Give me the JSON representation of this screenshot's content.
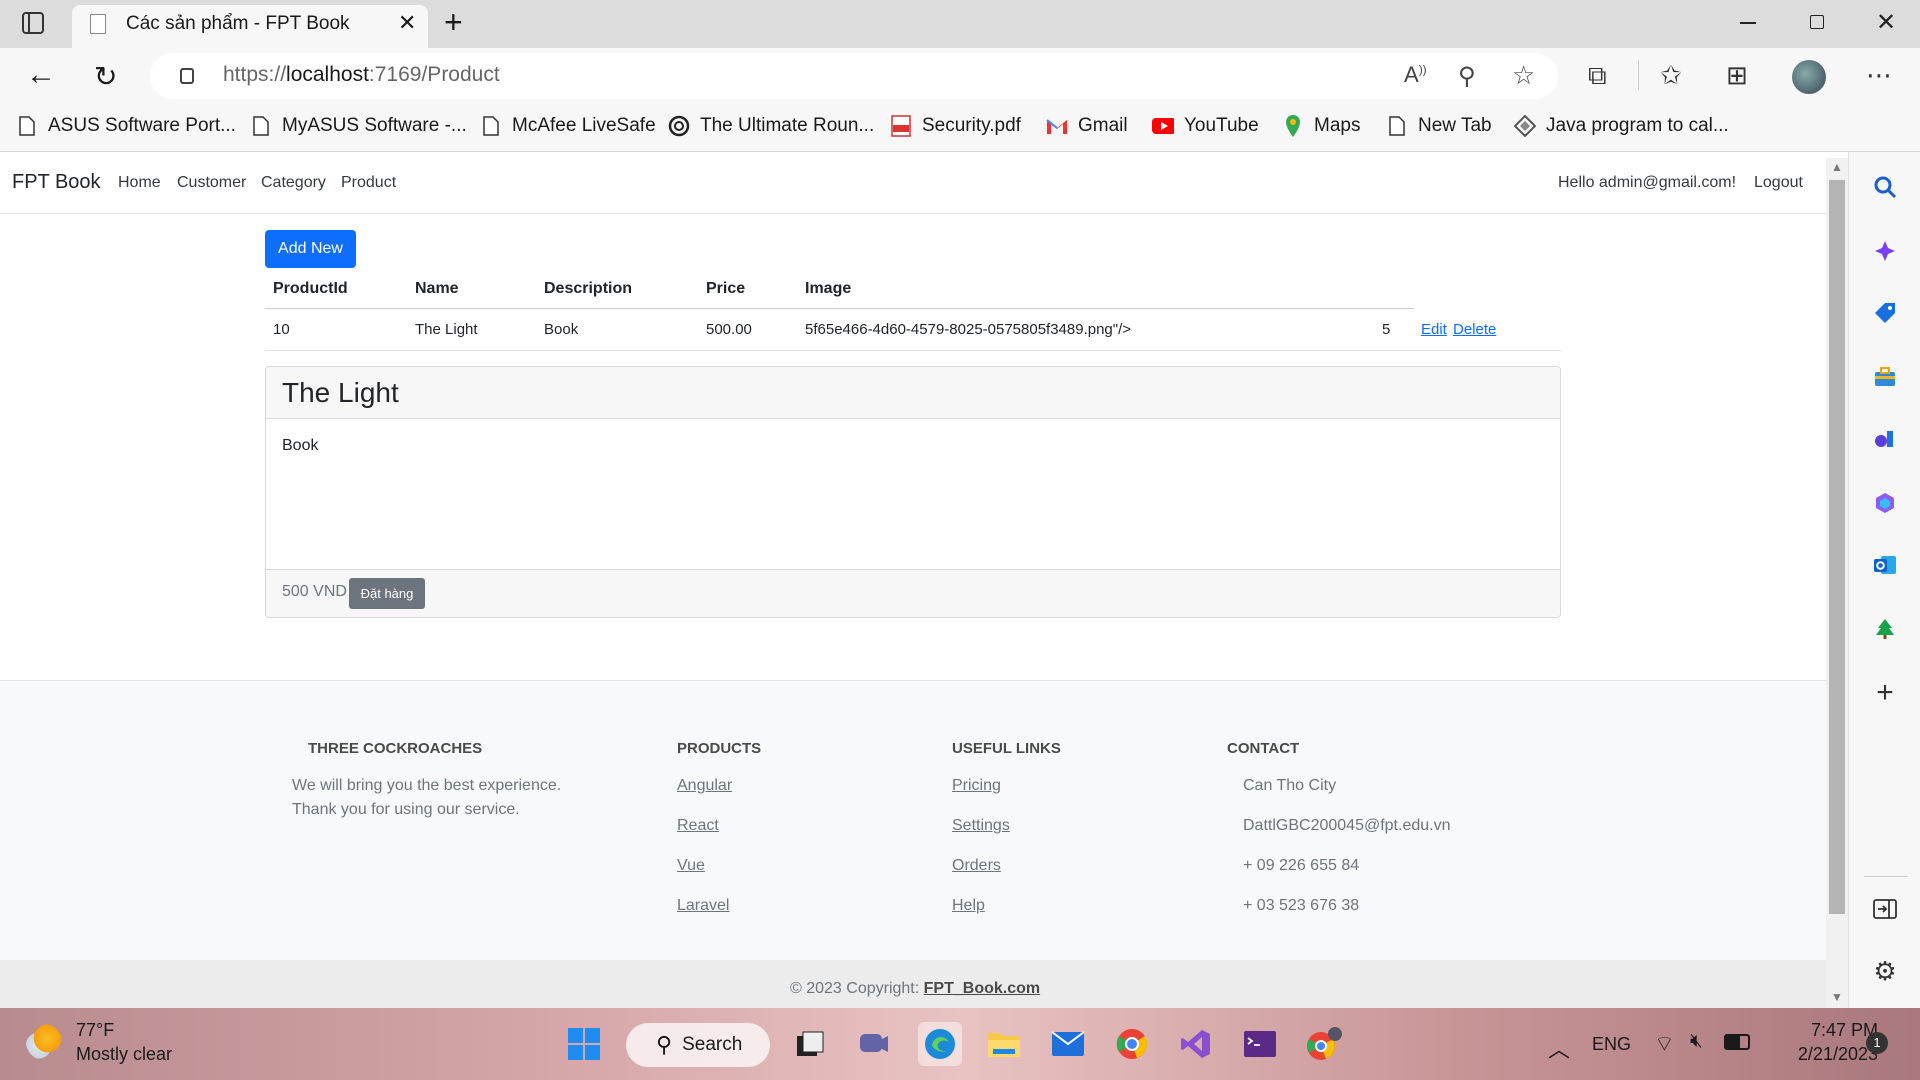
{
  "browser": {
    "tab_title": "Các sản phẩm - FPT Book",
    "url_prefix": "https://",
    "url_host": "localhost",
    "url_path": ":7169/Product",
    "bookmarks": [
      {
        "label": "ASUS Software Port...",
        "icon": "page-icon"
      },
      {
        "label": "MyASUS Software -...",
        "icon": "page-icon"
      },
      {
        "label": "McAfee LiveSafe",
        "icon": "page-icon"
      },
      {
        "label": "The Ultimate Roun...",
        "icon": "globe-icon"
      },
      {
        "label": "Security.pdf",
        "icon": "pdf-icon"
      },
      {
        "label": "Gmail",
        "icon": "gmail-icon"
      },
      {
        "label": "YouTube",
        "icon": "youtube-icon"
      },
      {
        "label": "Maps",
        "icon": "maps-icon"
      },
      {
        "label": "New Tab",
        "icon": "page-icon"
      },
      {
        "label": "Java program to cal...",
        "icon": "java-icon"
      }
    ]
  },
  "site": {
    "brand": "FPT Book",
    "nav": [
      "Home",
      "Customer",
      "Category",
      "Product"
    ],
    "greeting": "Hello admin@gmail.com!",
    "logout": "Logout"
  },
  "main": {
    "add_new": "Add New",
    "columns": [
      "ProductId",
      "Name",
      "Description",
      "Price",
      "Image"
    ],
    "rows": [
      {
        "id": "10",
        "name": "The Light",
        "description": "Book",
        "price": "500.00",
        "image": "5f65e466-4d60-4579-8025-0575805f3489.png\"/>",
        "qty": "5",
        "edit": "Edit",
        "delete": "Delete"
      }
    ],
    "card": {
      "title": "The Light",
      "body": "Book",
      "price": "500 VND",
      "order_button": "Đặt hàng"
    }
  },
  "footer": {
    "col1": {
      "title": "THREE COCKROACHES",
      "line1": "We will bring you the best experience.",
      "line2": "Thank you for using our service."
    },
    "col2": {
      "title": "PRODUCTS",
      "links": [
        "Angular",
        "React",
        "Vue",
        "Laravel"
      ]
    },
    "col3": {
      "title": "USEFUL LINKS",
      "links": [
        "Pricing",
        "Settings",
        "Orders",
        "Help"
      ]
    },
    "col4": {
      "title": "CONTACT",
      "items": [
        "Can Tho City",
        "DattlGBC200045@fpt.edu.vn",
        "+ 09 226 655 84",
        "+ 03 523 676 38"
      ]
    },
    "copyright_prefix": "© 2023 Copyright: ",
    "copyright_link": "FPT_Book.com"
  },
  "taskbar": {
    "weather_temp": "77°F",
    "weather_desc": "Mostly clear",
    "search": "Search",
    "lang": "ENG",
    "time": "7:47 PM",
    "date": "2/21/2023",
    "notif_count": "1"
  },
  "colors": {
    "primary": "#0d6efd",
    "link": "#0d6efd",
    "secondary_button": "#6c757d"
  }
}
